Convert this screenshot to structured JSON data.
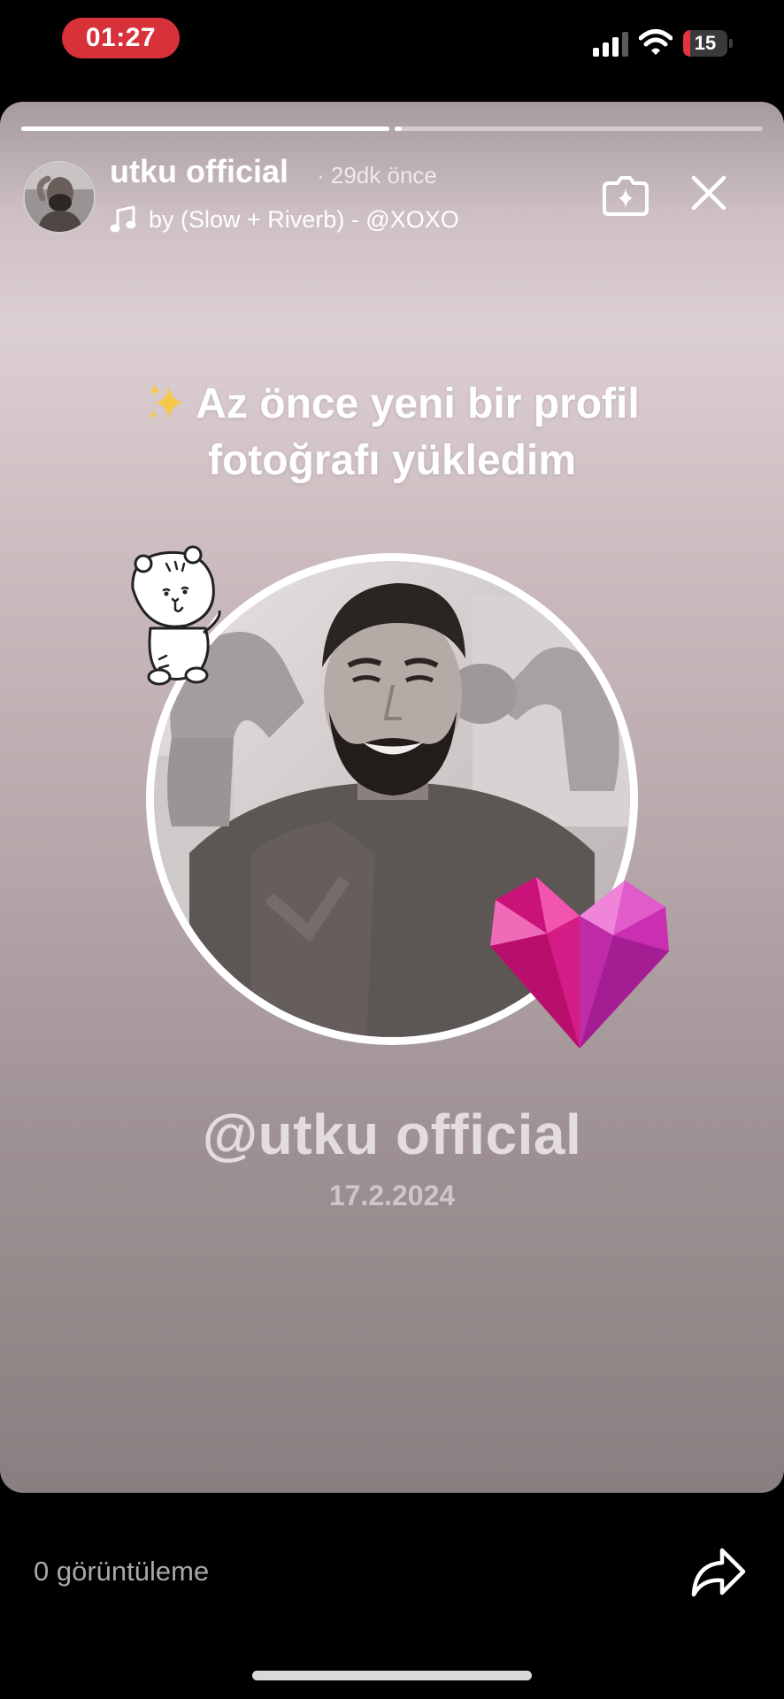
{
  "status_bar": {
    "time": "01:27",
    "battery_level": "15",
    "battery_fraction": 0.15,
    "signal_icon": "cellular-signal-icon",
    "wifi_icon": "wifi-icon"
  },
  "story": {
    "progress": [
      1.0,
      0.02
    ],
    "author_name": "utku official",
    "posted_ago": "· 29dk önce",
    "music_icon": "music-note-icon",
    "music_title": "by (Slow + Riverb) - @XOXO",
    "headline_line1": "Az önce yeni bir profil",
    "headline_line2": "fotoğrafı yükledim",
    "username": "@utku official",
    "date": "17.2.2024",
    "stickers": [
      "tiger-sticker",
      "pink-heart-sticker",
      "sparkle-icon"
    ]
  },
  "footer": {
    "views": "0 görüntüleme",
    "share_icon": "share-arrow-icon"
  },
  "colors": {
    "time_pill": "#d7313a",
    "battery_fill": "#e2343e",
    "heart_pink": "#e0288f"
  }
}
